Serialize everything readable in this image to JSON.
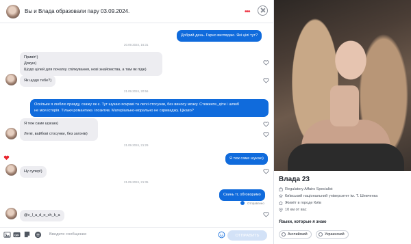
{
  "header": {
    "title": "Вы и Влада образовали пару 03.09.2024."
  },
  "messages": {
    "m1": "Добрий день. Гарно виглядаю. Які цілі тут?",
    "d1": "20.09.2024, 16:31",
    "m2_l1": "Привіт!)",
    "m2_l2": "Дякую)",
    "m2_l3": "Щодо цілей для початку спілкування, нові знайомства, а там як піде)",
    "m3": "Як щодо тебе?)",
    "d2": "21.09.2024, 20:56",
    "m4_l1": "Оскільки я люблю правду, скажу як є. Тут шукаю яскраві та легкі стосунки, без виносу мозку. Стежинте, діти і шлюб",
    "m4_l2": "не моя історія. Тільки романтика і позитив. Матеріально-морально не скриваджу. Цікаво?",
    "m5": "Я теж саме шукаю)",
    "m6": "Легкі, вайбові стосунки, без загонів)",
    "d3": "21.09.2024, 21:29",
    "m7": "Я теж саме шукаю)",
    "m8": "Ну супер!)",
    "d4": "21.09.2024, 21:35",
    "m9": "Скинь тг, обговоримо",
    "status": "Отправлено",
    "m10": "@v_l_a_d_o_ch_k_a"
  },
  "input": {
    "placeholder": "Введите сообщение",
    "send_label": "ОТПРАВИТЬ"
  },
  "profile": {
    "name": "Влада 23",
    "job": "Regulatory Affairs Specialist",
    "school": "Київський національний університет ім. Т. Шевченка",
    "city": "Живёт в городе Київ",
    "distance": "10 км от вас",
    "languages_title": "Языки, которые я знаю",
    "languages": [
      "Английский",
      "Украинский"
    ]
  },
  "colors": {
    "accent": "#106bdc",
    "brand": "#ee3b4a",
    "heart": "#e8262f"
  }
}
